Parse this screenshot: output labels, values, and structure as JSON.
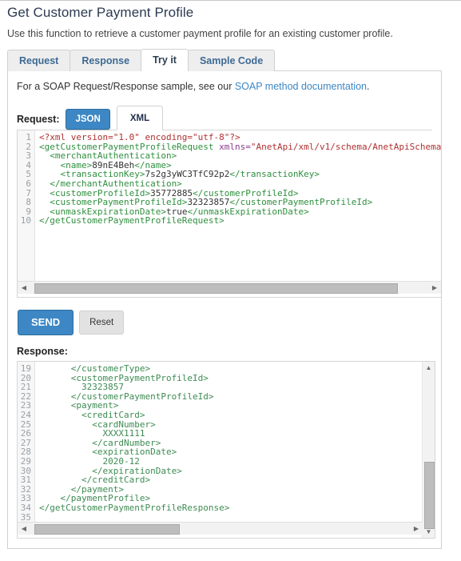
{
  "page": {
    "title": "Get Customer Payment Profile",
    "description": "Use this function to retrieve a customer payment profile for an existing customer profile."
  },
  "tabs": [
    {
      "label": "Request",
      "active": false
    },
    {
      "label": "Response",
      "active": false
    },
    {
      "label": "Try it",
      "active": true
    },
    {
      "label": "Sample Code",
      "active": false
    }
  ],
  "soap_note": {
    "text_before": "For a SOAP Request/Response sample, see our ",
    "link_text": "SOAP method documentation",
    "text_after": "."
  },
  "request": {
    "label": "Request:",
    "json_button": "JSON",
    "xml_tab": "XML",
    "line_numbers": [
      "1",
      "2",
      "3",
      "4",
      "5",
      "6",
      "7",
      "8",
      "9",
      "10"
    ],
    "lines": [
      [
        {
          "t": "val",
          "s": "<?xml version=\"1.0\" encoding=\"utf-8\"?>"
        }
      ],
      [
        {
          "t": "tag",
          "s": "<getCustomerPaymentProfileRequest "
        },
        {
          "t": "attr",
          "s": "xmlns="
        },
        {
          "t": "val",
          "s": "\"AnetApi/xml/v1/schema/AnetApiSchema"
        }
      ],
      [
        {
          "t": "tag",
          "s": "  <merchantAuthentication>"
        }
      ],
      [
        {
          "t": "tag",
          "s": "    <name>"
        },
        {
          "t": "txt",
          "s": "89nE4Beh"
        },
        {
          "t": "tag",
          "s": "</name>"
        }
      ],
      [
        {
          "t": "tag",
          "s": "    <transactionKey>"
        },
        {
          "t": "txt",
          "s": "7s2g3yWC3TfC92p2"
        },
        {
          "t": "tag",
          "s": "</transactionKey>"
        }
      ],
      [
        {
          "t": "tag",
          "s": "  </merchantAuthentication>"
        }
      ],
      [
        {
          "t": "tag",
          "s": "  <customerProfileId>"
        },
        {
          "t": "txt",
          "s": "35772885"
        },
        {
          "t": "tag",
          "s": "</customerProfileId>"
        }
      ],
      [
        {
          "t": "tag",
          "s": "  <customerPaymentProfileId>"
        },
        {
          "t": "txt",
          "s": "32323857"
        },
        {
          "t": "tag",
          "s": "</customerPaymentProfileId>"
        }
      ],
      [
        {
          "t": "tag",
          "s": "  <unmaskExpirationDate>"
        },
        {
          "t": "txt",
          "s": "true"
        },
        {
          "t": "tag",
          "s": "</unmaskExpirationDate>"
        }
      ],
      [
        {
          "t": "tag",
          "s": "</getCustomerPaymentProfileRequest>"
        }
      ]
    ],
    "hscroll": {
      "thumb_left_pct": 1,
      "thumb_width_pct": 91
    }
  },
  "actions": {
    "send_label": "SEND",
    "reset_label": "Reset"
  },
  "response": {
    "label": "Response:",
    "line_numbers": [
      "19",
      "20",
      "21",
      "22",
      "23",
      "24",
      "25",
      "26",
      "27",
      "28",
      "29",
      "30",
      "31",
      "32",
      "33",
      "34",
      "35"
    ],
    "lines": [
      "      </customerType>",
      "      <customerPaymentProfileId>",
      "        32323857",
      "      </customerPaymentProfileId>",
      "      <payment>",
      "        <creditCard>",
      "          <cardNumber>",
      "            XXXX1111",
      "          </cardNumber>",
      "          <expirationDate>",
      "            2020-12",
      "          </expirationDate>",
      "        </creditCard>",
      "      </payment>",
      "    </paymentProfile>",
      "</getCustomerPaymentProfileResponse>",
      ""
    ],
    "vscroll": {
      "thumb_top_pct": 57,
      "thumb_height_pct": 37
    },
    "hscroll": {
      "thumb_left_pct": 1,
      "thumb_width_pct": 38
    }
  },
  "icons": {
    "scroll_left": "◀",
    "scroll_right": "▶",
    "scroll_up": "▲",
    "scroll_down": "▼"
  },
  "colors": {
    "accent_blue": "#3c87c4",
    "link_blue": "#3c87c4",
    "tab_text": "#3d6a94",
    "xml_tag": "#2f8f3e",
    "xml_attr": "#8a3b8f",
    "xml_value": "#b03030",
    "response_text": "#3d8b52"
  }
}
